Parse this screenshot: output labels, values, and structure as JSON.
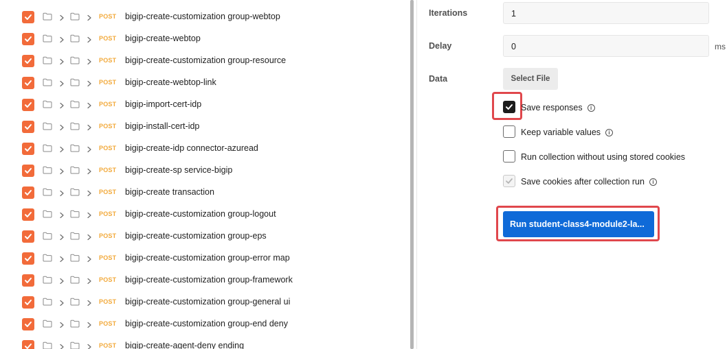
{
  "requests": [
    {
      "method": "POST",
      "name": "bigip-create-customization group-webtop"
    },
    {
      "method": "POST",
      "name": "bigip-create-webtop"
    },
    {
      "method": "POST",
      "name": "bigip-create-customization group-resource"
    },
    {
      "method": "POST",
      "name": "bigip-create-webtop-link"
    },
    {
      "method": "POST",
      "name": "bigip-import-cert-idp"
    },
    {
      "method": "POST",
      "name": "bigip-install-cert-idp"
    },
    {
      "method": "POST",
      "name": "bigip-create-idp connector-azuread"
    },
    {
      "method": "POST",
      "name": "bigip-create-sp service-bigip"
    },
    {
      "method": "POST",
      "name": "bigip-create transaction"
    },
    {
      "method": "POST",
      "name": "bigip-create-customization group-logout"
    },
    {
      "method": "POST",
      "name": "bigip-create-customization group-eps"
    },
    {
      "method": "POST",
      "name": "bigip-create-customization group-error map"
    },
    {
      "method": "POST",
      "name": "bigip-create-customization group-framework"
    },
    {
      "method": "POST",
      "name": "bigip-create-customization group-general ui"
    },
    {
      "method": "POST",
      "name": "bigip-create-customization group-end deny"
    },
    {
      "method": "POST",
      "name": "bigip-create-agent-deny ending"
    }
  ],
  "settings": {
    "iterations_label": "Iterations",
    "iterations_value": "1",
    "delay_label": "Delay",
    "delay_value": "0",
    "delay_unit": "ms",
    "data_label": "Data",
    "select_file_label": "Select File"
  },
  "options": {
    "save_responses": {
      "label": "Save responses",
      "checked": true
    },
    "keep_variable_values": {
      "label": "Keep variable values",
      "checked": false
    },
    "run_without_cookies": {
      "label": "Run collection without using stored cookies",
      "checked": false
    },
    "save_cookies": {
      "label": "Save cookies after collection run",
      "checked": true,
      "disabled": true
    }
  },
  "run_button_label": "Run student-class4-module2-la...",
  "colors": {
    "accent_orange": "#f26b3a",
    "post_method": "#f2a93a",
    "run_button": "#0f6ad8",
    "highlight": "#e0474c"
  }
}
